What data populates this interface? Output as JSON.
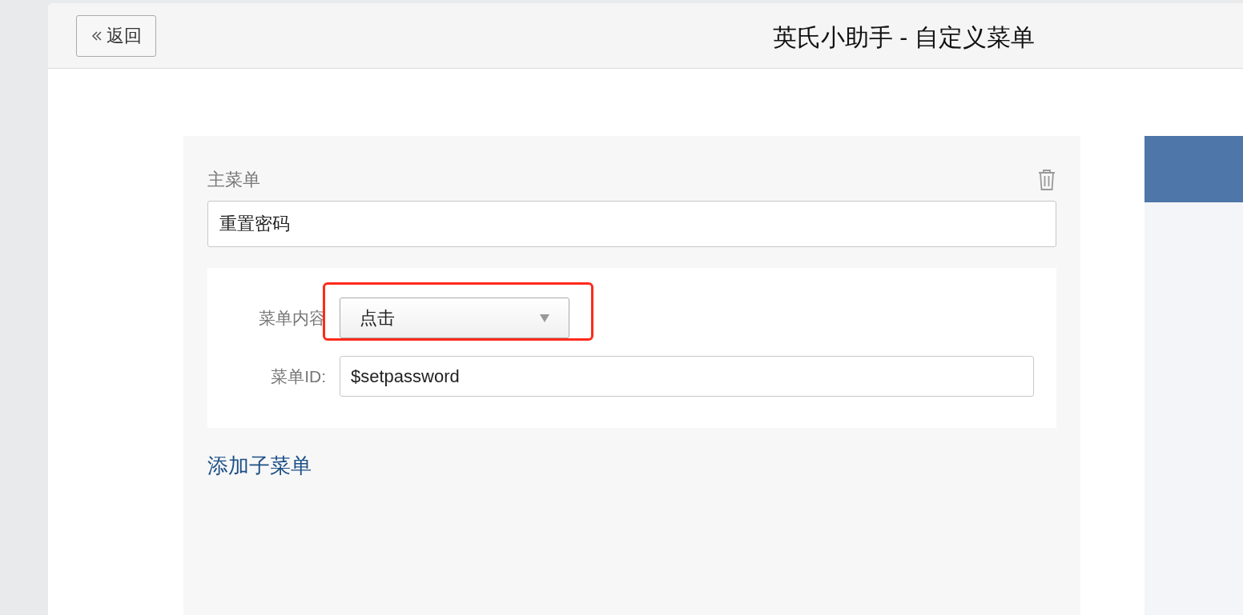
{
  "header": {
    "back_button": "返回",
    "title": "英氏小助手 - 自定义菜单"
  },
  "menu": {
    "label": "主菜单",
    "name_value": "重置密码",
    "fields": [
      {
        "kind": "select",
        "label": "菜单内容",
        "value": "点击",
        "highlighted": true
      },
      {
        "kind": "text",
        "label": "菜单ID:",
        "value": "$setpassword",
        "highlighted": false
      }
    ],
    "add_link": "添加子菜单"
  }
}
